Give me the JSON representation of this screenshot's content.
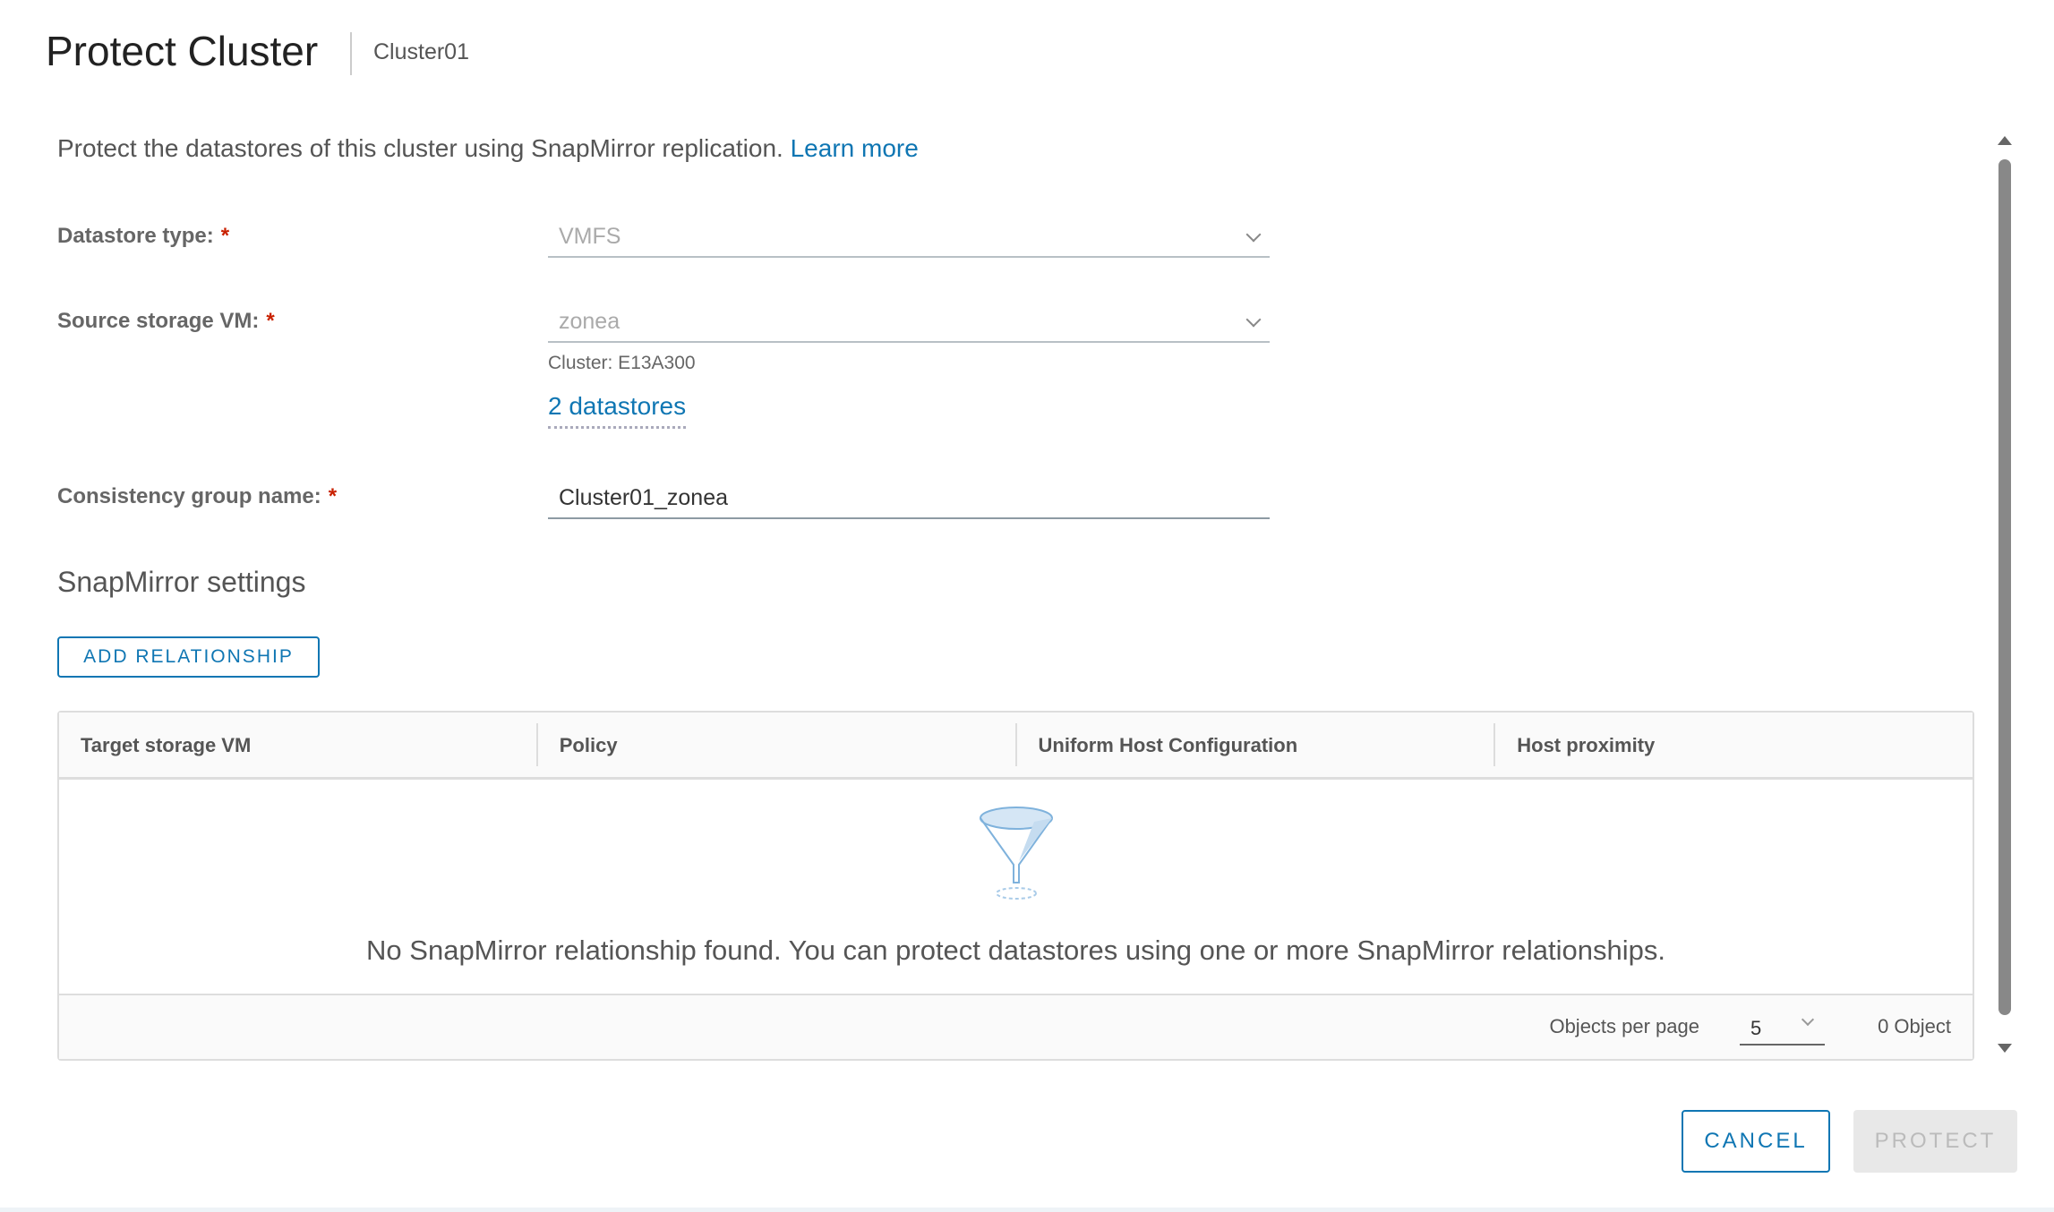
{
  "header": {
    "title": "Protect Cluster",
    "subtitle": "Cluster01"
  },
  "description": {
    "text": "Protect the datastores of this cluster using SnapMirror replication.",
    "link": "Learn more"
  },
  "form": {
    "datastore_type": {
      "label": "Datastore type:",
      "required": "*",
      "value": "VMFS"
    },
    "source_vm": {
      "label": "Source storage VM:",
      "required": "*",
      "value": "zonea",
      "hint": "Cluster: E13A300",
      "datastores_link": "2 datastores"
    },
    "cg_name": {
      "label": "Consistency group name:",
      "required": "*",
      "value": "Cluster01_zonea"
    }
  },
  "snapmirror": {
    "title": "SnapMirror settings",
    "add_button": "ADD RELATIONSHIP",
    "columns": [
      "Target storage VM",
      "Policy",
      "Uniform Host Configuration",
      "Host proximity"
    ],
    "empty_message": "No SnapMirror relationship found. You can protect datastores using one or more SnapMirror relationships.",
    "footer": {
      "per_page_label": "Objects per page",
      "per_page_value": "5",
      "count": "0 Object"
    }
  },
  "actions": {
    "cancel": "CANCEL",
    "protect": "PROTECT"
  },
  "colors": {
    "accent": "#0f76b3",
    "required": "#c92100"
  }
}
